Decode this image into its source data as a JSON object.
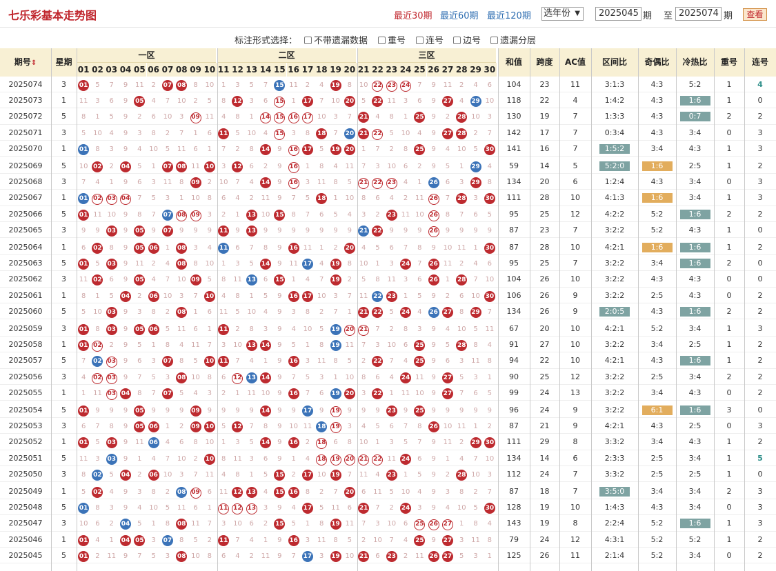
{
  "header": {
    "title": "七乐彩基本走势图",
    "ranges": [
      "最近30期",
      "最近60期",
      "最近120期"
    ],
    "year_select": "选年份",
    "from": "2025045",
    "to": "2025074",
    "qi": "期",
    "zhi": "至",
    "view": "查看"
  },
  "options": {
    "label": "标注形式选择：",
    "items": [
      "不带遗漏数据",
      "重号",
      "连号",
      "边号",
      "遗漏分层"
    ]
  },
  "columns": {
    "period": "期号",
    "weekday": "星期",
    "zones": [
      "一区",
      "二区",
      "三区"
    ],
    "numbers": [
      "01",
      "02",
      "03",
      "04",
      "05",
      "06",
      "07",
      "08",
      "09",
      "10",
      "11",
      "12",
      "13",
      "14",
      "15",
      "16",
      "17",
      "18",
      "19",
      "20",
      "21",
      "22",
      "23",
      "24",
      "25",
      "26",
      "27",
      "28",
      "29",
      "30"
    ],
    "stats": [
      "和值",
      "跨度",
      "AC值",
      "区间比",
      "奇偶比",
      "冷热比",
      "重号",
      "连号"
    ]
  },
  "rows": [
    {
      "p": "2025074",
      "w": "3",
      "n": [
        1,
        7,
        8,
        15,
        19,
        22,
        23,
        24
      ],
      "blue": [
        15
      ],
      "ring": [
        22,
        23,
        24
      ],
      "s": [
        "104",
        "23",
        "11",
        "3:1:3",
        "4:3",
        "5:2",
        "1",
        "4"
      ]
    },
    {
      "p": "2025073",
      "w": "1",
      "n": [
        5,
        12,
        15,
        17,
        20,
        22,
        27,
        29
      ],
      "blue": [
        29
      ],
      "ring": [
        15
      ],
      "s": [
        "118",
        "22",
        "4",
        "1:4:2",
        "4:3",
        "1:6",
        "1",
        "0"
      ]
    },
    {
      "p": "2025072",
      "w": "5",
      "n": [
        9,
        14,
        15,
        16,
        17,
        21,
        25,
        28
      ],
      "blue": [],
      "ring": [
        9,
        14,
        15,
        16,
        17
      ],
      "s": [
        "130",
        "19",
        "7",
        "1:3:3",
        "4:3",
        "0:7",
        "2",
        "2"
      ]
    },
    {
      "p": "2025071",
      "w": "3",
      "n": [
        11,
        15,
        18,
        20,
        21,
        22,
        27,
        28
      ],
      "blue": [
        20
      ],
      "ring": [
        15,
        22
      ],
      "s": [
        "142",
        "17",
        "7",
        "0:3:4",
        "4:3",
        "3:4",
        "0",
        "3"
      ]
    },
    {
      "p": "2025070",
      "w": "1",
      "n": [
        1,
        14,
        16,
        17,
        19,
        20,
        25,
        30
      ],
      "blue": [
        1
      ],
      "ring": [
        16
      ],
      "s": [
        "141",
        "16",
        "7",
        "1:5:2",
        "3:4",
        "4:3",
        "1",
        "3"
      ]
    },
    {
      "p": "2025069",
      "w": "5",
      "n": [
        2,
        4,
        7,
        8,
        10,
        12,
        16,
        29
      ],
      "blue": [
        29
      ],
      "ring": [
        16
      ],
      "s": [
        "59",
        "14",
        "5",
        "5:2:0",
        "1:6",
        "2:5",
        "1",
        "2"
      ]
    },
    {
      "p": "2025068",
      "w": "3",
      "n": [
        9,
        14,
        16,
        21,
        22,
        23,
        26,
        29
      ],
      "blue": [
        26
      ],
      "ring": [
        16,
        21,
        22,
        23
      ],
      "s": [
        "134",
        "20",
        "6",
        "1:2:4",
        "4:3",
        "3:4",
        "0",
        "3"
      ]
    },
    {
      "p": "2025067",
      "w": "1",
      "n": [
        1,
        2,
        3,
        4,
        18,
        26,
        28,
        30
      ],
      "blue": [
        1
      ],
      "ring": [
        2,
        3,
        4,
        26
      ],
      "s": [
        "111",
        "28",
        "10",
        "4:1:3",
        "1:6",
        "3:4",
        "1",
        "3"
      ]
    },
    {
      "p": "2025066",
      "w": "5",
      "n": [
        1,
        7,
        8,
        9,
        13,
        15,
        23,
        26
      ],
      "blue": [
        7
      ],
      "ring": [
        8,
        9,
        26
      ],
      "s": [
        "95",
        "25",
        "12",
        "4:2:2",
        "5:2",
        "1:6",
        "2",
        "2"
      ]
    },
    {
      "p": "2025065",
      "w": "3",
      "n": [
        3,
        5,
        7,
        11,
        13,
        21,
        22,
        26
      ],
      "blue": [
        21
      ],
      "ring": [
        26
      ],
      "s": [
        "87",
        "23",
        "7",
        "3:2:2",
        "5:2",
        "4:3",
        "1",
        "0"
      ]
    },
    {
      "p": "2025064",
      "w": "1",
      "n": [
        2,
        5,
        6,
        8,
        11,
        16,
        20,
        30
      ],
      "blue": [
        11
      ],
      "ring": [],
      "s": [
        "87",
        "28",
        "10",
        "4:2:1",
        "1:6",
        "1:6",
        "1",
        "2"
      ]
    },
    {
      "p": "2025063",
      "w": "5",
      "n": [
        1,
        3,
        8,
        14,
        17,
        19,
        24,
        26
      ],
      "blue": [
        17
      ],
      "ring": [],
      "s": [
        "95",
        "25",
        "7",
        "3:2:2",
        "3:4",
        "1:6",
        "2",
        "0"
      ]
    },
    {
      "p": "2025062",
      "w": "3",
      "n": [
        2,
        5,
        9,
        13,
        15,
        19,
        26,
        28
      ],
      "blue": [
        13
      ],
      "ring": [],
      "s": [
        "104",
        "26",
        "10",
        "3:2:2",
        "4:3",
        "4:3",
        "0",
        "0"
      ]
    },
    {
      "p": "2025061",
      "w": "1",
      "n": [
        4,
        6,
        10,
        16,
        17,
        22,
        23,
        30
      ],
      "blue": [
        22
      ],
      "ring": [],
      "s": [
        "106",
        "26",
        "9",
        "3:2:2",
        "2:5",
        "4:3",
        "0",
        "2"
      ]
    },
    {
      "p": "2025060",
      "w": "5",
      "n": [
        3,
        8,
        21,
        22,
        24,
        26,
        27,
        29
      ],
      "blue": [
        26
      ],
      "ring": [],
      "s": [
        "134",
        "26",
        "9",
        "2:0:5",
        "4:3",
        "1:6",
        "2",
        "2"
      ]
    },
    {
      "p": "2025059",
      "w": "3",
      "n": [
        1,
        3,
        5,
        6,
        11,
        19,
        20,
        21
      ],
      "blue": [
        19
      ],
      "ring": [
        20,
        21
      ],
      "s": [
        "67",
        "20",
        "10",
        "4:2:1",
        "5:2",
        "3:4",
        "1",
        "3"
      ]
    },
    {
      "p": "2025058",
      "w": "1",
      "n": [
        1,
        2,
        13,
        14,
        19,
        25,
        28
      ],
      "blue": [
        19
      ],
      "ring": [
        2
      ],
      "s": [
        "91",
        "27",
        "10",
        "3:2:2",
        "3:4",
        "2:5",
        "1",
        "2"
      ]
    },
    {
      "p": "2025057",
      "w": "5",
      "n": [
        2,
        3,
        7,
        10,
        11,
        16,
        22,
        25
      ],
      "blue": [
        2
      ],
      "ring": [
        3
      ],
      "s": [
        "94",
        "22",
        "10",
        "4:2:1",
        "4:3",
        "1:6",
        "1",
        "2"
      ]
    },
    {
      "p": "2025056",
      "w": "3",
      "n": [
        2,
        3,
        8,
        12,
        13,
        14,
        24,
        27
      ],
      "blue": [
        13
      ],
      "ring": [
        2,
        3,
        12
      ],
      "s": [
        "90",
        "25",
        "12",
        "3:2:2",
        "2:5",
        "3:4",
        "2",
        "2"
      ]
    },
    {
      "p": "2025055",
      "w": "1",
      "n": [
        3,
        4,
        7,
        16,
        19,
        20,
        22,
        27
      ],
      "blue": [
        19
      ],
      "ring": [
        3
      ],
      "s": [
        "99",
        "24",
        "13",
        "3:2:2",
        "3:4",
        "4:3",
        "0",
        "2"
      ]
    },
    {
      "p": "2025054",
      "w": "5",
      "n": [
        1,
        5,
        9,
        14,
        17,
        19,
        23,
        25
      ],
      "blue": [
        17
      ],
      "ring": [
        19
      ],
      "s": [
        "96",
        "24",
        "9",
        "3:2:2",
        "6:1",
        "1:6",
        "3",
        "0"
      ]
    },
    {
      "p": "2025053",
      "w": "3",
      "n": [
        5,
        6,
        9,
        10,
        12,
        18,
        19,
        26
      ],
      "blue": [
        18
      ],
      "ring": [
        19
      ],
      "s": [
        "87",
        "21",
        "9",
        "4:2:1",
        "4:3",
        "2:5",
        "0",
        "3"
      ]
    },
    {
      "p": "2025052",
      "w": "1",
      "n": [
        1,
        3,
        6,
        14,
        16,
        18,
        29,
        30
      ],
      "blue": [
        6
      ],
      "ring": [
        18
      ],
      "s": [
        "111",
        "29",
        "8",
        "3:3:2",
        "3:4",
        "4:3",
        "1",
        "2"
      ]
    },
    {
      "p": "2025051",
      "w": "5",
      "n": [
        3,
        10,
        18,
        19,
        20,
        21,
        22,
        24
      ],
      "blue": [
        3
      ],
      "ring": [
        18,
        19,
        20,
        21,
        22
      ],
      "s": [
        "134",
        "14",
        "6",
        "2:3:3",
        "2:5",
        "3:4",
        "1",
        "5"
      ]
    },
    {
      "p": "2025050",
      "w": "3",
      "n": [
        2,
        4,
        6,
        15,
        17,
        19,
        23,
        28
      ],
      "blue": [
        2
      ],
      "ring": [],
      "s": [
        "112",
        "24",
        "7",
        "3:3:2",
        "2:5",
        "2:5",
        "1",
        "0"
      ]
    },
    {
      "p": "2025049",
      "w": "1",
      "n": [
        2,
        8,
        9,
        12,
        13,
        15,
        16,
        20
      ],
      "blue": [
        8
      ],
      "ring": [
        9
      ],
      "s": [
        "87",
        "18",
        "7",
        "3:5:0",
        "3:4",
        "3:4",
        "2",
        "3"
      ]
    },
    {
      "p": "2025048",
      "w": "5",
      "n": [
        1,
        11,
        12,
        13,
        17,
        21,
        24,
        30
      ],
      "blue": [
        1
      ],
      "ring": [
        11,
        12,
        13
      ],
      "s": [
        "128",
        "19",
        "10",
        "1:4:3",
        "4:3",
        "3:4",
        "0",
        "3"
      ]
    },
    {
      "p": "2025047",
      "w": "3",
      "n": [
        4,
        8,
        15,
        19,
        25,
        26,
        27
      ],
      "blue": [
        4
      ],
      "ring": [
        25,
        26,
        27
      ],
      "s": [
        "143",
        "19",
        "8",
        "2:2:4",
        "5:2",
        "1:6",
        "1",
        "3"
      ]
    },
    {
      "p": "2025046",
      "w": "1",
      "n": [
        1,
        4,
        5,
        7,
        11,
        16,
        25,
        27
      ],
      "blue": [
        7
      ],
      "ring": [],
      "s": [
        "79",
        "24",
        "12",
        "4:3:1",
        "5:2",
        "5:2",
        "1",
        "2"
      ]
    },
    {
      "p": "2025045",
      "w": "5",
      "n": [
        1,
        8,
        17,
        19,
        21,
        23,
        26,
        27
      ],
      "blue": [
        17
      ],
      "ring": [],
      "s": [
        "125",
        "26",
        "11",
        "2:1:4",
        "5:2",
        "3:4",
        "0",
        "2"
      ]
    }
  ]
}
